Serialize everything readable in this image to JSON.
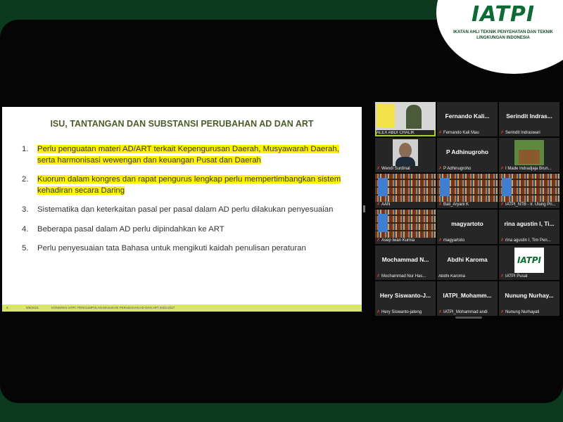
{
  "logo": {
    "mark": "IATPI",
    "subtitle": "IKATAN AHLI TEKNIK PENYEHATAN DAN TEKNIK LINGKUNGAN INDONESIA"
  },
  "slide": {
    "title": "ISU, TANTANGAN DAN SUBSTANSI PERUBAHAN AD DAN ART",
    "points": [
      {
        "num": "1.",
        "text": "Perlu penguatan materi AD/ART terkait Kepengurusan Daerah, Musyawarah Daerah, serta harmonisasi wewengan dan keuangan Pusat dan Daerah",
        "highlight": true
      },
      {
        "num": "2.",
        "text": "Kuorum dalam kongres dan rapat pengurus lengkap perlu mempertimbangkan sistem kehadiran secara Daring",
        "highlight": true
      },
      {
        "num": "3.",
        "text": "Sistematika dan keterkaitan pasal per pasal dalam AD perlu dilakukan penyesuaian",
        "highlight": false
      },
      {
        "num": "4.",
        "text": "Beberapa pasal dalam AD perlu dipindahkan ke ART",
        "highlight": false
      },
      {
        "num": "5.",
        "text": "Perlu penyesuaian tata Bahasa untuk mengikuti kaidah penulisan peraturan",
        "highlight": false
      }
    ],
    "footer": {
      "page": "6",
      "date": "9/8/2023",
      "caption": "KONGRES IATPI: PENGUMPULAN MASUKAN PERUBAHAN AD DAN ART 2023-2027"
    }
  },
  "participants": [
    {
      "title": "",
      "name": "ALEX ABDI CHALIK",
      "video": "presenter",
      "active": true,
      "muted": false
    },
    {
      "title": "Fernando Kali...",
      "name": "Fernando Kali Mau",
      "video": "none",
      "active": false,
      "muted": true
    },
    {
      "title": "Serindit Indras...",
      "name": "Serindit Indraswari",
      "video": "none",
      "active": false,
      "muted": true
    },
    {
      "title": "",
      "name": "Wendi Surdinal",
      "video": "face",
      "active": false,
      "muted": true
    },
    {
      "title": "P Adhinugroho",
      "name": "P Adhinugroho",
      "video": "none",
      "active": false,
      "muted": true
    },
    {
      "title": "",
      "name": "I Made Indradjaja Brun...",
      "video": "house",
      "active": false,
      "muted": true
    },
    {
      "title": "",
      "name": "AAN",
      "video": "books",
      "active": false,
      "muted": true
    },
    {
      "title": "",
      "name": "Bali_Aryani K",
      "video": "books",
      "active": false,
      "muted": true
    },
    {
      "title": "",
      "name": "IATPI_NTB - Ir. Ulung Pri...",
      "video": "books",
      "active": false,
      "muted": true
    },
    {
      "title": "",
      "name": "Asep Iwan Kurnia",
      "video": "books",
      "active": false,
      "muted": true
    },
    {
      "title": "magyartoto",
      "name": "magyartoto",
      "video": "none",
      "active": false,
      "muted": true
    },
    {
      "title": "rina agustin I, Ti...",
      "name": "rina agustin I, Tim Pen...",
      "video": "none",
      "active": false,
      "muted": true
    },
    {
      "title": "Mochammad N...",
      "name": "Mochammad Nur Has...",
      "video": "none",
      "active": false,
      "muted": true
    },
    {
      "title": "Abdhi Karoma",
      "name": "Abdhi Karoma",
      "video": "none",
      "active": false,
      "muted": false
    },
    {
      "title": "",
      "name": "IATPI Pusat",
      "video": "logo",
      "active": false,
      "muted": true
    },
    {
      "title": "Hery Siswanto-J...",
      "name": "Hery Siswanto-jateng",
      "video": "none",
      "active": false,
      "muted": true
    },
    {
      "title": "IATPI_Mohamm...",
      "name": "IATPI_Mohammad andi",
      "video": "none",
      "active": false,
      "muted": true
    },
    {
      "title": "Nunung Nurhay...",
      "name": "Nunung Nurhayati",
      "video": "none",
      "active": false,
      "muted": true
    }
  ],
  "icons": {
    "mic_muted": "mic-muted-icon"
  },
  "colors": {
    "accent": "#a6d22a",
    "highlight": "#fff200",
    "brand": "#0d6b33"
  }
}
